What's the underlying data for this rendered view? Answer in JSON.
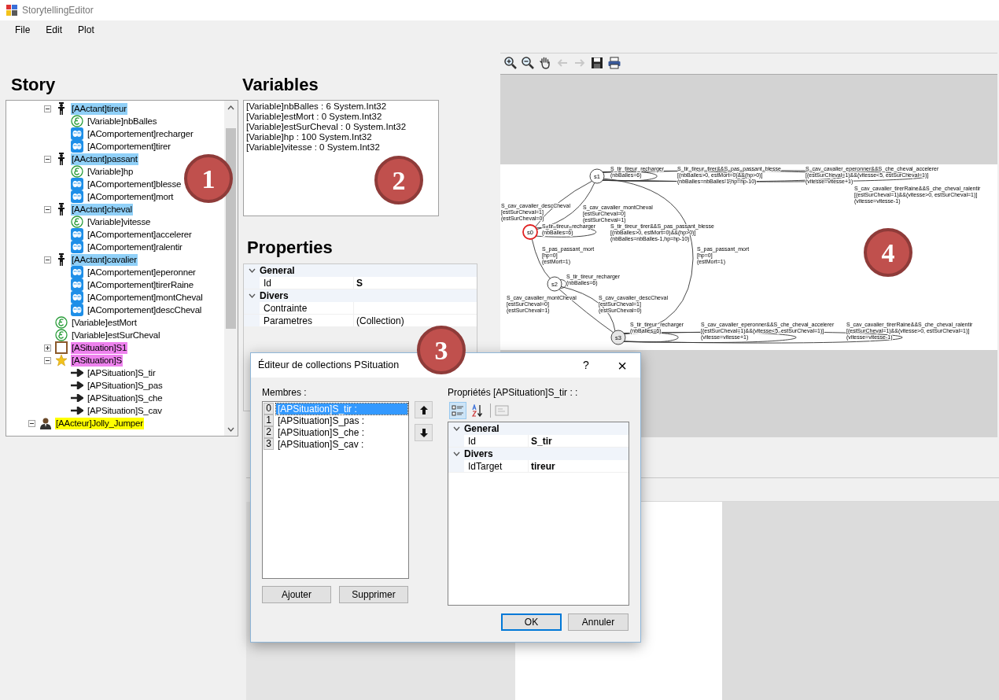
{
  "window": {
    "title": "StorytellingEditor"
  },
  "menu": [
    "File",
    "Edit",
    "Plot"
  ],
  "story": {
    "title": "Story",
    "tree": {
      "continued_children": [
        {
          "kind": "actor",
          "label": "[AActant]tireur",
          "color": "#90d0f8",
          "expanded": true,
          "children": [
            {
              "kind": "variable",
              "label": "[Variable]nbBalles"
            },
            {
              "kind": "behavior",
              "label": "[AComportement]recharger"
            },
            {
              "kind": "behavior",
              "label": "[AComportement]tirer"
            }
          ]
        },
        {
          "kind": "actor",
          "label": "[AActant]passant",
          "color": "#90d0f8",
          "expanded": true,
          "children": [
            {
              "kind": "variable",
              "label": "[Variable]hp"
            },
            {
              "kind": "behavior",
              "label": "[AComportement]blesse"
            },
            {
              "kind": "behavior",
              "label": "[AComportement]mort"
            }
          ]
        },
        {
          "kind": "actor",
          "label": "[AActant]cheval",
          "color": "#90d0f8",
          "expanded": true,
          "children": [
            {
              "kind": "variable",
              "label": "[Variable]vitesse"
            },
            {
              "kind": "behavior",
              "label": "[AComportement]accelerer"
            },
            {
              "kind": "behavior",
              "label": "[AComportement]ralentir"
            }
          ]
        },
        {
          "kind": "actor",
          "label": "[AActant]cavalier",
          "color": "#90d0f8",
          "expanded": true,
          "children": [
            {
              "kind": "behavior",
              "label": "[AComportement]eperonner"
            },
            {
              "kind": "behavior",
              "label": "[AComportement]tirerRaine"
            },
            {
              "kind": "behavior",
              "label": "[AComportement]montCheval"
            },
            {
              "kind": "behavior",
              "label": "[AComportement]descCheval"
            }
          ]
        },
        {
          "kind": "variable",
          "label": "[Variable]estMort"
        },
        {
          "kind": "variable",
          "label": "[Variable]estSurCheval"
        },
        {
          "kind": "situation",
          "label": "[ASituation]S1",
          "color": "#ee82ee",
          "expanded": false
        },
        {
          "kind": "initial_situation",
          "label": "[ASituation]S",
          "color": "#ee82ee",
          "expanded": true,
          "children": [
            {
              "kind": "psituation",
              "label": "[APSituation]S_tir"
            },
            {
              "kind": "psituation",
              "label": "[APSituation]S_pas"
            },
            {
              "kind": "psituation",
              "label": "[APSituation]S_che"
            },
            {
              "kind": "psituation",
              "label": "[APSituation]S_cav"
            }
          ]
        }
      ],
      "items": [
        {
          "kind": "acteur",
          "label": "[AActeur]Jolly_Jumper",
          "color": "#ffff00",
          "expanded": true
        }
      ]
    }
  },
  "variables": {
    "title": "Variables",
    "lines": [
      "[Variable]nbBalles : 6 System.Int32",
      "[Variable]estMort : 0 System.Int32",
      "[Variable]estSurCheval : 0 System.Int32",
      "[Variable]hp : 100 System.Int32",
      "[Variable]vitesse : 0 System.Int32"
    ]
  },
  "properties": {
    "title": "Properties",
    "categories": [
      {
        "name": "General",
        "expanded": true,
        "rows": [
          {
            "name": "Id",
            "value": "S",
            "modified": true
          }
        ]
      },
      {
        "name": "Divers",
        "expanded": true,
        "rows": [
          {
            "name": "Contrainte"
          },
          {
            "name": "Parametres",
            "value": "(Collection)",
            "modified": false
          }
        ]
      }
    ]
  },
  "plot": {
    "toolbar": [
      {
        "kind": "zoom_in",
        "disabled": false
      },
      {
        "kind": "zoom_out",
        "disabled": false
      },
      {
        "kind": "pan",
        "disabled": false
      },
      {
        "kind": "back",
        "disabled": true
      },
      {
        "kind": "forward",
        "disabled": true
      },
      {
        "kind": "save",
        "disabled": false
      },
      {
        "kind": "print",
        "disabled": false
      }
    ],
    "graph": {
      "nodes": [
        {
          "label": "s1",
          "highlighted": false
        },
        {
          "label": "s0",
          "highlighted": true
        },
        {
          "label": "s2",
          "highlighted": false
        },
        {
          "label": "s3",
          "highlighted": false
        }
      ],
      "transitions": [
        {
          "lines": [
            "S_tir_tireur_recharger",
            "(nbBalles=6)"
          ]
        },
        {
          "lines": [
            "S_tir_tireur_tirer&&S_pas_passant_blesse",
            "[(nbBalles>0, estMort=0)&&(hp>0)]",
            "(nbBalles=nbBalles-1,hp=hp-10)"
          ]
        },
        {
          "lines": [
            "S_cav_cavalier_eperonner&&S_che_cheval_accelerer",
            "[(estSurCheval=1)&&(vitesse<5, estSurCheval=1)]",
            "(vitesse=vitesse+1)"
          ]
        },
        {
          "lines": [
            "S_cav_cavalier_tirerRaine&&S_che_cheval_ralentir",
            "[(estSurCheval=1)&&(vitesse>0, estSurCheval=1)]",
            "(vitesse=vitesse-1)"
          ]
        },
        {
          "lines": [
            "S_cav_cavalier_descCheval",
            "[estSurCheval=1]",
            "(estSurCheval=0)"
          ]
        },
        {
          "lines": [
            "S_cav_cavalier_montCheval",
            "[estSurCheval=0]",
            "(estSurCheval=1)"
          ]
        },
        {
          "lines": [
            "S_tir_tireur_recharger",
            "(nbBalles=6)"
          ]
        },
        {
          "lines": [
            "S_tir_tireur_tirer&&S_pas_passant_blesse",
            "[(nbBalles>0, estMort=0)&&(hp>0)]",
            "(nbBalles=nbBalles-1,hp=hp-10)"
          ]
        },
        {
          "lines": [
            "S_pas_passant_mort",
            "[hp=0]",
            "(estMort=1)"
          ]
        },
        {
          "lines": [
            "S_pas_passant_mort",
            "[hp=0]",
            "(estMort=1)"
          ]
        },
        {
          "lines": [
            "S_tir_tireur_recharger",
            "(nbBalles=6)"
          ]
        },
        {
          "lines": [
            "S_cav_cavalier_montCheval",
            "[estSurCheval=0]",
            "(estSurCheval=1)"
          ]
        },
        {
          "lines": [
            "S_cav_cavalier_descCheval",
            "[estSurCheval=1]",
            "(estSurCheval=0)"
          ]
        },
        {
          "lines": [
            "S_tir_tireur_recharger",
            "(nbBalles=6)"
          ]
        },
        {
          "lines": [
            "S_cav_cavalier_eperonner&&S_che_cheval_accelerer",
            "[(estSurCheval=1)&&(vitesse<5, estSurCheval=1)]",
            "(vitesse=vitesse+1)"
          ]
        },
        {
          "lines": [
            "S_cav_cavalier_tirerRaine&&S_che_cheval_ralentir",
            "[(estSurCheval=1)&&(vitesse>0, estSurCheval=1)]",
            "(vitesse=vitesse-1)"
          ]
        }
      ]
    }
  },
  "dialog": {
    "title": "Éditeur de collections PSituation",
    "help": "?",
    "close": "×",
    "members_label": "Membres :",
    "members": [
      {
        "index": "0",
        "label": "[APSituation]S_tir :",
        "selected": true
      },
      {
        "index": "1",
        "label": "[APSituation]S_pas :",
        "selected": false
      },
      {
        "index": "2",
        "label": "[APSituation]S_che :",
        "selected": false
      },
      {
        "index": "3",
        "label": "[APSituation]S_cav :",
        "selected": false
      }
    ],
    "add_button": "Ajouter",
    "remove_button": "Supprimer",
    "properties_label": "Propriétés [APSituation]S_tir :  :",
    "view_modes": [
      {
        "kind": "categorized",
        "selected": true
      },
      {
        "kind": "alphabetical",
        "selected": false
      }
    ],
    "categories": [
      {
        "name": "General",
        "expanded": true,
        "rows": [
          {
            "name": "Id",
            "value": "S_tir",
            "modified": true
          }
        ]
      },
      {
        "name": "Divers",
        "expanded": true,
        "rows": [
          {
            "name": "IdTarget",
            "value": "tireur",
            "modified": true
          }
        ]
      }
    ],
    "ok_button": "OK",
    "cancel_button": "Annuler"
  },
  "callouts": [
    "1",
    "2",
    "3",
    "4"
  ]
}
